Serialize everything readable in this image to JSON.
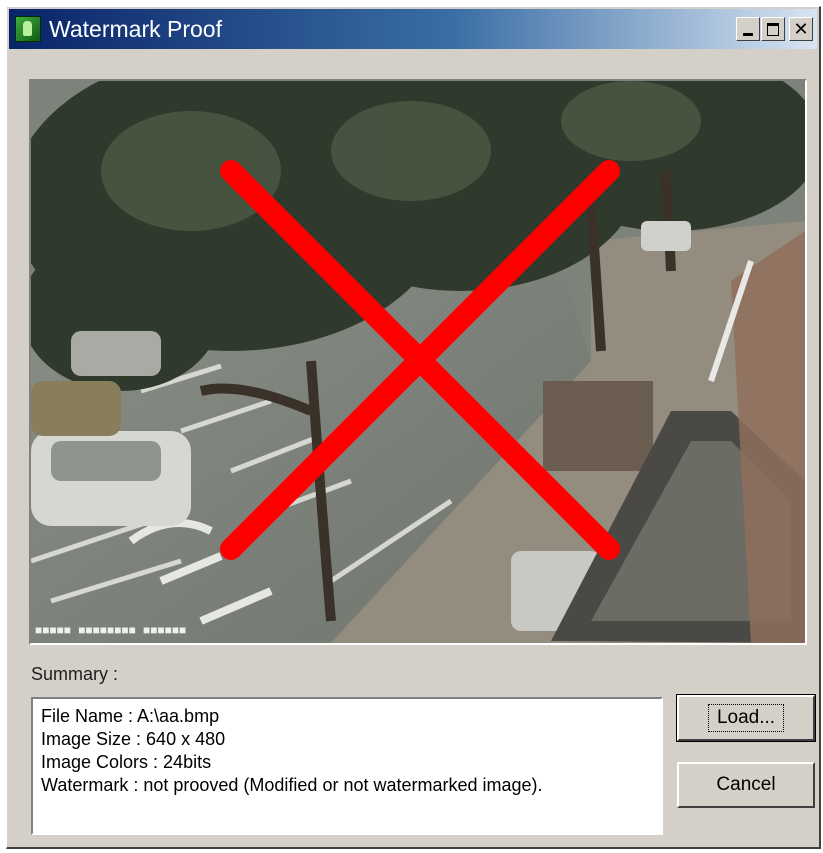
{
  "window": {
    "title": "Watermark Proof",
    "icon": "app-icon",
    "controls": [
      "minimize-icon",
      "maximize-icon",
      "close-icon"
    ]
  },
  "viewer": {
    "overlay_icon": "red-x-cross-icon",
    "overlay_color": "#ff0000"
  },
  "summary": {
    "label": "Summary :",
    "lines": [
      "File Name : A:\\aa.bmp",
      "Image Size : 640 x 480",
      "Image Colors : 24bits",
      "Watermark : not prooved (Modified or not watermarked image)."
    ]
  },
  "buttons": {
    "load": "Load...",
    "cancel": "Cancel"
  }
}
